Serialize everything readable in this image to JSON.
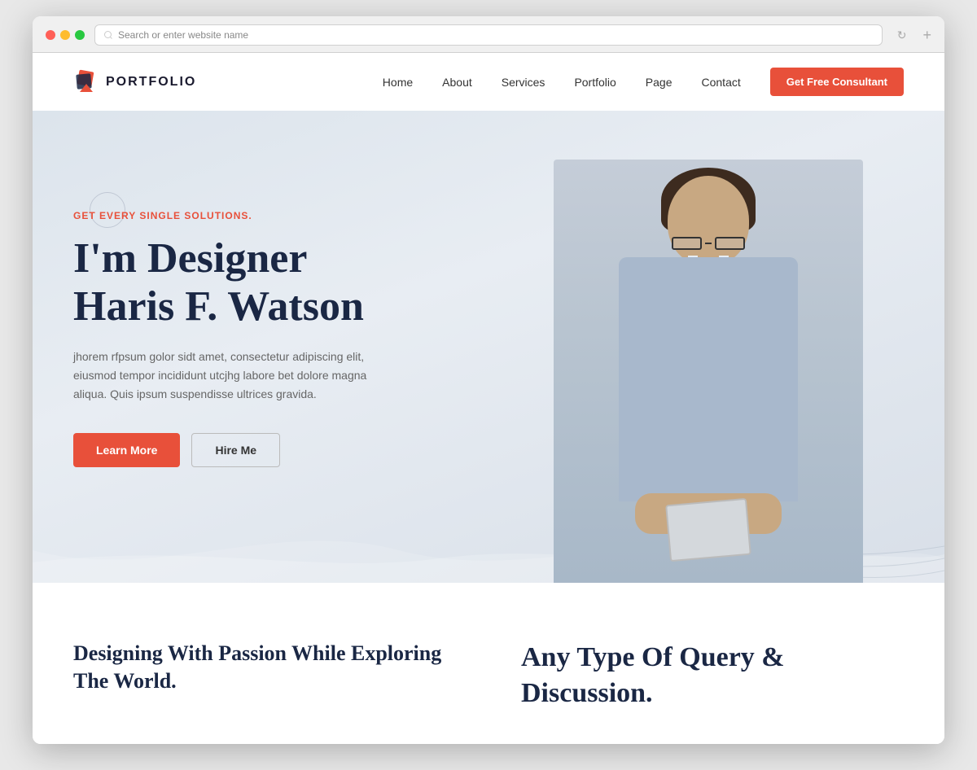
{
  "browser": {
    "address_placeholder": "Search or enter website name"
  },
  "navbar": {
    "logo_text": "PORTFOLIO",
    "links": [
      "Home",
      "About",
      "Services",
      "Portfolio",
      "Page",
      "Contact"
    ],
    "cta_label": "Get Free Consultant"
  },
  "hero": {
    "subtitle": "GET EVERY SINGLE SOLUTIONS.",
    "title_line1": "I'm Designer",
    "title_line2": "Haris F. Watson",
    "description": "jhorem rfpsum golor sidt amet, consectetur adipiscing elit, eiusmod tempor incididunt utcjhg labore bet dolore magna aliqua. Quis ipsum suspendisse ultrices gravida.",
    "btn_primary": "Learn More",
    "btn_outline": "Hire Me"
  },
  "below": {
    "left_title": "Designing With Passion While Exploring The World.",
    "right_title": "Any Type Of Query & Discussion."
  },
  "colors": {
    "accent": "#e8503a",
    "dark": "#1a2744"
  }
}
